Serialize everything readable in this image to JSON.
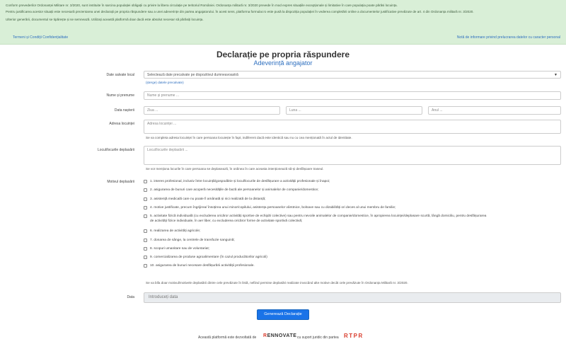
{
  "banner": {
    "line1": "Conform prevederilor Ordonanței Militare nr. 3/2020, sunt instituite în sarcina populației obligații cu privire la libera circulație pe teritoriul României. Ordonanța militară nr. 3/2020 prevede în mod expres situațiile excepționale și limitative în care populația poate părăsi locuința.",
    "line2": "Pentru justificarea acestor situații este necesară prezentarea unei declarații pe propria răspundere sau a unei adeverințe din partea angajatorului. În acest sens, platforma formular.ro este pusă la dispoziția populației în vederea completării online a documentelor justificative prevăzute de art. 4 din Ordonanța militară nr. 3/2020.",
    "line3": "Ulterior generării, documentul se tipărește și se semnează. Utilizați această platformă doar dacă este absolut necesar să părăsiți locuința.",
    "links_left": "Termeni și Condiții  Confidențialitate",
    "links_right": "Notă de informare privind prelucrarea datelor cu caracter personal"
  },
  "title": "Declarație pe propria răspundere",
  "subtitle": "Adeverință angajator",
  "form": {
    "saved_label": "Date salvate local",
    "saved_select": "Selectează date precalvate pe dispozitivul dumneavoastră",
    "delete_link": "(șterge) datele precalvate)",
    "name_label": "Nume și prenume",
    "name_placeholder": "Nume și prenume ...",
    "birth_label": "Data nașterii",
    "day_placeholder": "Ziua ...",
    "month_placeholder": "Luna ...",
    "year_placeholder": "Anul ...",
    "address_label": "Adresa locuinței",
    "address_placeholder": "Adresa locuinței ...",
    "address_hint": "Se va completa adresa locuinței în care persoana locuiește în fapt, indiferent dacă este identică sau nu cu cea menționată în actul de identitate.",
    "places_label": "Locul/locurile deplasării",
    "places_placeholder": "Locul/locurile deplasării ...",
    "places_hint": "Se vor menționa locurile în care persoana se deplasează, în ordinea în care aceasta intenționează să-și desfășoare traseul.",
    "reasons_label": "Motivul deplasării",
    "reasons": [
      "1. interes profesional, inclusiv între locuință/gospodărie și locul/locurile de desfășurare a activității profesionale și înapoi;",
      "2. asigurarea de bunuri care acoperă necesitățile de bază ale persoanelor și animalelor de companie/domestice;",
      "3. asistență medicală care nu poate fi amânată și nici realizată de la distanță;",
      "4. motive justificate, precum îngrijirea/ însoțirea unui minor/copilului, asistența persoanelor vârstnice, bolnave sau cu dizabilități ori deces al unui membru de familie;",
      "5. activitate fizică individuală (cu excluderea oricăror activități sportive de echipă/ colective) sau pentru nevoile animalelor de companie/domestice, în apropierea locuinței/deplasare scurtă, lângă domiciliu, pentru desfășurarea",
      "de activități fizice individuale, în aer liber, cu excluderea oricăror forme de activitate sportivă colectivă;",
      "6. realizarea de activități agricole;",
      "7. donarea de sânge, la centrele de transfuzie sanguină;",
      "8. scopuri umanitare sau de voluntariat;",
      "9. comercializarea de produse agroalimentare (în cazul producătorilor agricoli)",
      "10. asigurarea de bunuri necesare desfășurării activității profesionale."
    ],
    "reasons_hint": "Se va bifa doar motivul/motivele deplasării dintre cele prevăzute în listă, nefiind permise deplasări realizate invocând alte motive decât cele prevăzute în Ordonanța Militară nr. 3/2020.",
    "date_label": "Data",
    "date_placeholder": "Introduceți data",
    "submit": "Generează Declarație"
  },
  "footer": {
    "text1": "Această platformă este dezvoltată de",
    "brand1_r": "R",
    "brand1_rest": "ENNOVATE",
    "text2": "cu suport juridic din partea",
    "brand2": "RTPR"
  }
}
